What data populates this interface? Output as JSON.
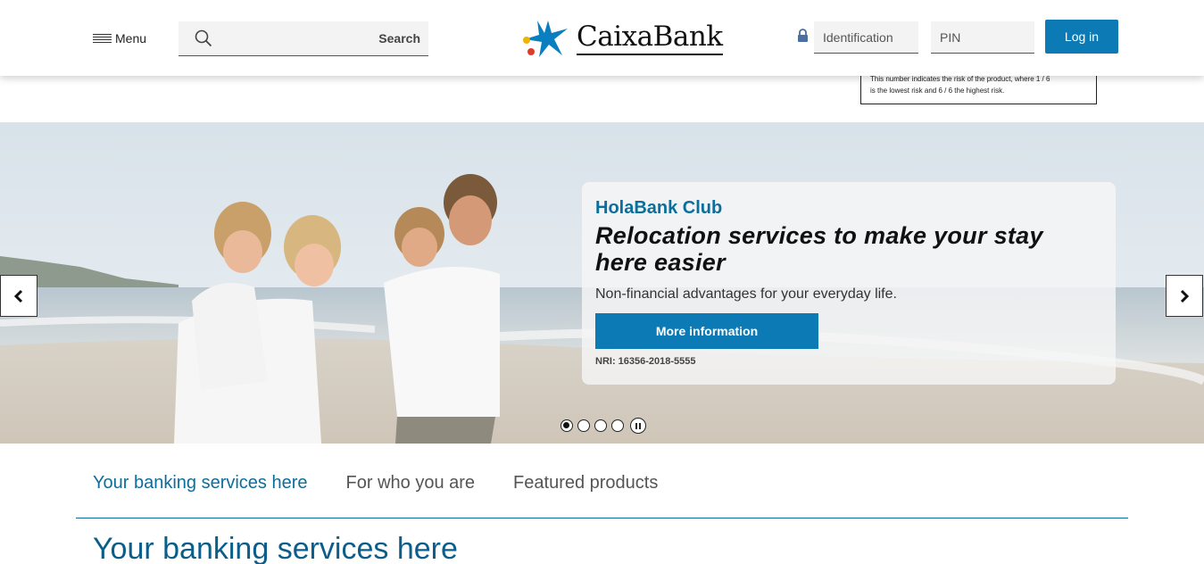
{
  "header": {
    "menu_label": "Menu",
    "search_label": "Search",
    "logo_text": "CaixaBank",
    "identification_placeholder": "Identification",
    "pin_placeholder": "PIN",
    "login_label": "Log in"
  },
  "risk_note": {
    "line1": "This number indicates the risk of the product, where 1 / 6",
    "line2": "is the lowest risk and 6 / 6 the highest risk."
  },
  "hero": {
    "kicker": "HolaBank Club",
    "headline": "Relocation services to make your stay here easier",
    "subtitle": "Non-financial advantages for your everyday life.",
    "cta_label": "More information",
    "nri": "NRI: 16356-2018-5555",
    "slide_count": 4,
    "active_slide": 1
  },
  "tabs": [
    {
      "label": "Your banking services here"
    },
    {
      "label": "For who you are"
    },
    {
      "label": "Featured products"
    }
  ],
  "section_title": "Your banking services here",
  "colors": {
    "brand_blue": "#0b7ab5",
    "title_blue": "#0b6e9c"
  },
  "icons": {
    "menu": "hamburger-icon",
    "search": "search-icon",
    "lock": "lock-icon",
    "prev": "chevron-left-icon",
    "next": "chevron-right-icon"
  }
}
